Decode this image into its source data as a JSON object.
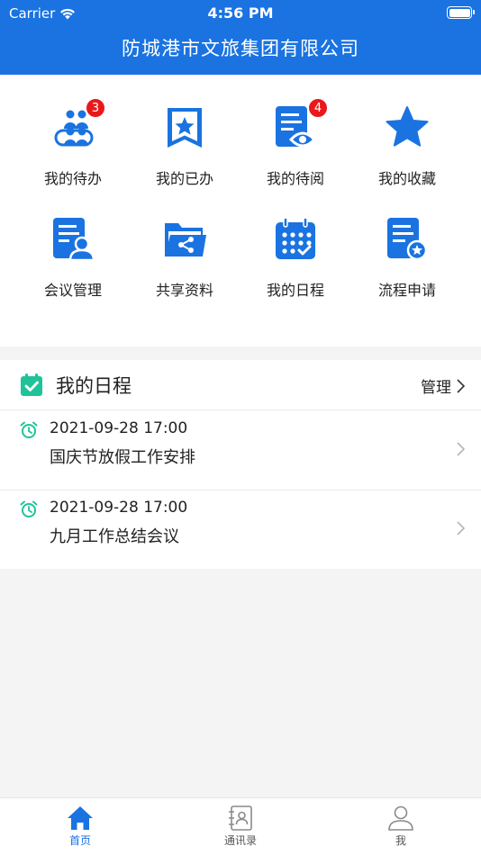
{
  "status_bar": {
    "carrier": "Carrier",
    "time": "4:56 PM"
  },
  "header": {
    "title": "防城港市文旅集团有限公司"
  },
  "colors": {
    "primary": "#1a73e0",
    "badge": "#e8191b",
    "schedule_accent": "#1fc39a",
    "tab_inactive": "#8a8a8a"
  },
  "grid": {
    "items": [
      {
        "label": "我的待办",
        "icon": "people-icon",
        "badge": "3"
      },
      {
        "label": "我的已办",
        "icon": "bookmark-star-icon"
      },
      {
        "label": "我的待阅",
        "icon": "document-eye-icon",
        "badge": "4"
      },
      {
        "label": "我的收藏",
        "icon": "star-icon"
      },
      {
        "label": "会议管理",
        "icon": "document-user-icon"
      },
      {
        "label": "共享资料",
        "icon": "folder-share-icon"
      },
      {
        "label": "我的日程",
        "icon": "calendar-icon"
      },
      {
        "label": "流程申请",
        "icon": "document-star-icon"
      }
    ]
  },
  "schedule": {
    "title": "我的日程",
    "manage_label": "管理",
    "items": [
      {
        "time": "2021-09-28 17:00",
        "title": "国庆节放假工作安排"
      },
      {
        "time": "2021-09-28 17:00",
        "title": "九月工作总结会议"
      }
    ]
  },
  "tabbar": {
    "tabs": [
      {
        "label": "首页",
        "icon": "home-icon",
        "active": true
      },
      {
        "label": "通讯录",
        "icon": "contacts-icon",
        "active": false
      },
      {
        "label": "我",
        "icon": "user-icon",
        "active": false
      }
    ]
  }
}
